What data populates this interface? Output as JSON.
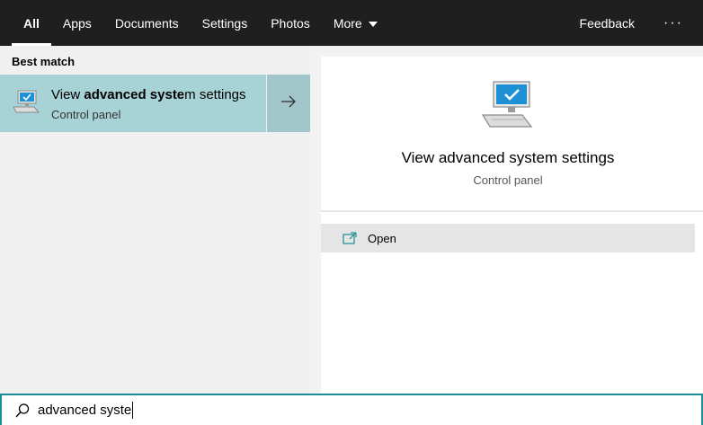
{
  "tabs": [
    {
      "label": "All",
      "active": true
    },
    {
      "label": "Apps"
    },
    {
      "label": "Documents"
    },
    {
      "label": "Settings"
    },
    {
      "label": "Photos"
    },
    {
      "label": "More"
    }
  ],
  "header": {
    "feedback_label": "Feedback",
    "more_options_label": "···"
  },
  "left": {
    "section_title": "Best match",
    "best_match": {
      "title_pre": "View ",
      "title_bold": "advanced syste",
      "title_post": "m settings",
      "subtitle": "Control panel"
    }
  },
  "preview": {
    "title": "View advanced system settings",
    "subtitle": "Control panel",
    "actions": [
      {
        "label": "Open"
      }
    ]
  },
  "search": {
    "value": "advanced syste"
  },
  "colors": {
    "topbar": "#1f1f1f",
    "highlight": "#a8d3d6",
    "accent": "#1b8e94"
  },
  "icons": {
    "result": "computer-monitor-icon",
    "arrow": "arrow-right-icon",
    "open": "open-window-icon",
    "search": "search-icon"
  }
}
